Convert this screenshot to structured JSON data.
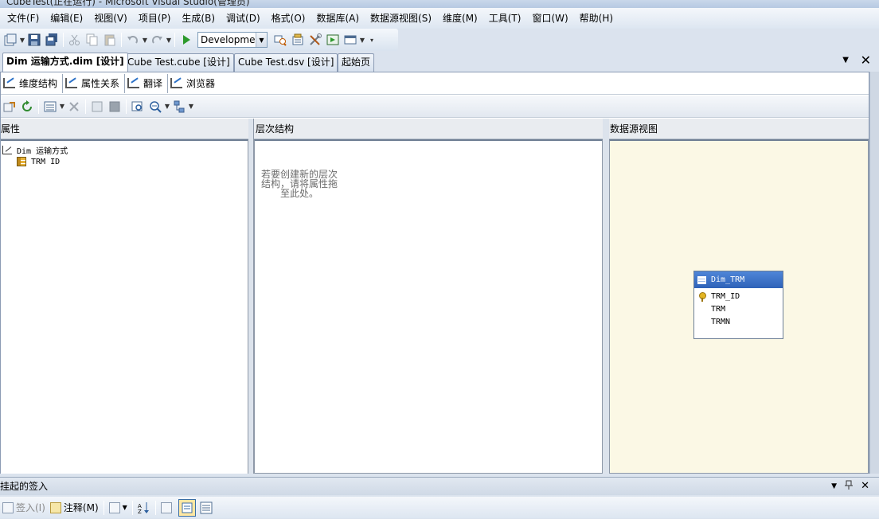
{
  "window": {
    "title": "CubeTest(正在运行) - Microsoft Visual Studio(管理员)"
  },
  "menu": [
    "文件(F)",
    "编辑(E)",
    "视图(V)",
    "项目(P)",
    "生成(B)",
    "调试(D)",
    "格式(O)",
    "数据库(A)",
    "数据源视图(S)",
    "维度(M)",
    "工具(T)",
    "窗口(W)",
    "帮助(H)"
  ],
  "toolbar": {
    "configuration": "Development",
    "icons": [
      "new-project-icon",
      "save-icon",
      "save-all-icon",
      "cut-icon",
      "copy-icon",
      "paste-icon",
      "undo-icon",
      "redo-icon",
      "start-icon",
      "find-icon",
      "properties-icon",
      "tools-icon",
      "deploy-icon",
      "window-icon"
    ]
  },
  "doc_tabs": [
    {
      "label": "Dim 运输方式.dim [设计]",
      "active": true
    },
    {
      "label": "Cube Test.cube [设计]",
      "active": false
    },
    {
      "label": "Cube Test.dsv [设计]",
      "active": false
    },
    {
      "label": "起始页",
      "active": false
    }
  ],
  "designer": {
    "tabs": [
      "维度结构",
      "属性关系",
      "翻译",
      "浏览器"
    ],
    "panes": {
      "attributes": {
        "header": "属性",
        "dimension": "Dim 运输方式",
        "attributes": [
          "TRM ID"
        ]
      },
      "hierarchies": {
        "header": "层次结构",
        "hint_lines": [
          "若要创建新的层次",
          "结构，请将属性拖",
          "至此处。"
        ]
      },
      "dsv": {
        "header": "数据源视图",
        "table": {
          "name": "Dim_TRM",
          "columns": [
            "TRM_ID",
            "TRM",
            "TRMN"
          ],
          "key_column": "TRM_ID"
        }
      }
    }
  },
  "bottom_panel": {
    "title": "挂起的签入",
    "buttons": {
      "checkin": "签入(I)",
      "comment": "注释(M)"
    }
  },
  "colors": {
    "dsv_background": "#fbf8e5",
    "table_header": "#2e62b8"
  }
}
